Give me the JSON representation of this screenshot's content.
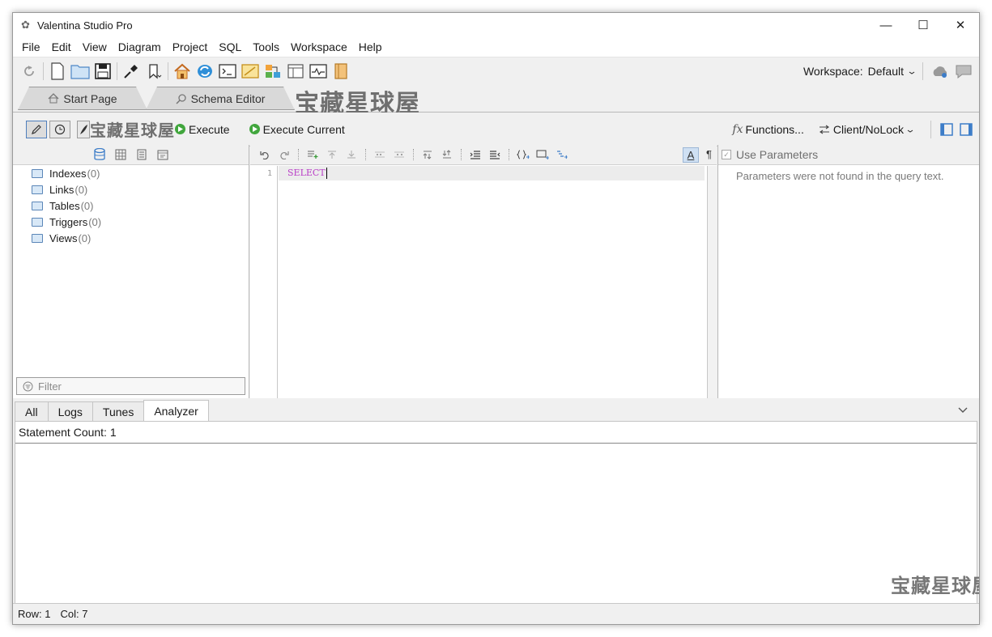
{
  "window": {
    "title": "Valentina Studio Pro",
    "minimize": "—",
    "maximize": "☐",
    "close": "✕"
  },
  "menu": [
    "File",
    "Edit",
    "View",
    "Diagram",
    "Project",
    "SQL",
    "Tools",
    "Workspace",
    "Help"
  ],
  "toolbar": {
    "workspace_label": "Workspace:",
    "workspace_value": "Default"
  },
  "tabs": [
    {
      "label": "Start Page",
      "icon": "home-icon"
    },
    {
      "label": "Schema Editor",
      "icon": "search-icon"
    }
  ],
  "watermark": "宝藏星球屋",
  "editor_toolbar": {
    "execute_label": "Execute",
    "execute_current_label": "Execute Current",
    "functions_label": "Functions...",
    "functions_prefix": "fx",
    "client_label": "Client/NoLock"
  },
  "tree": {
    "items": [
      {
        "label": "Indexes",
        "count": "(0)"
      },
      {
        "label": "Links",
        "count": "(0)"
      },
      {
        "label": "Tables",
        "count": "(0)"
      },
      {
        "label": "Triggers",
        "count": "(0)"
      },
      {
        "label": "Views",
        "count": "(0)"
      }
    ],
    "filter_placeholder": "Filter"
  },
  "editor": {
    "line_number": "1",
    "code": "SELECT"
  },
  "params": {
    "use_parameters": "Use Parameters",
    "message": "Parameters were not found in the query text."
  },
  "bottom_tabs": [
    "All",
    "Logs",
    "Tunes",
    "Analyzer"
  ],
  "bottom_active": "Analyzer",
  "analyzer": {
    "statement_count": "Statement Count: 1"
  },
  "status": {
    "row": "Row: 1",
    "col": "Col: 7"
  },
  "colors": {
    "accent": "#3d7dc8",
    "keyword": "#b93ec7",
    "execute_green": "#41a63d"
  }
}
